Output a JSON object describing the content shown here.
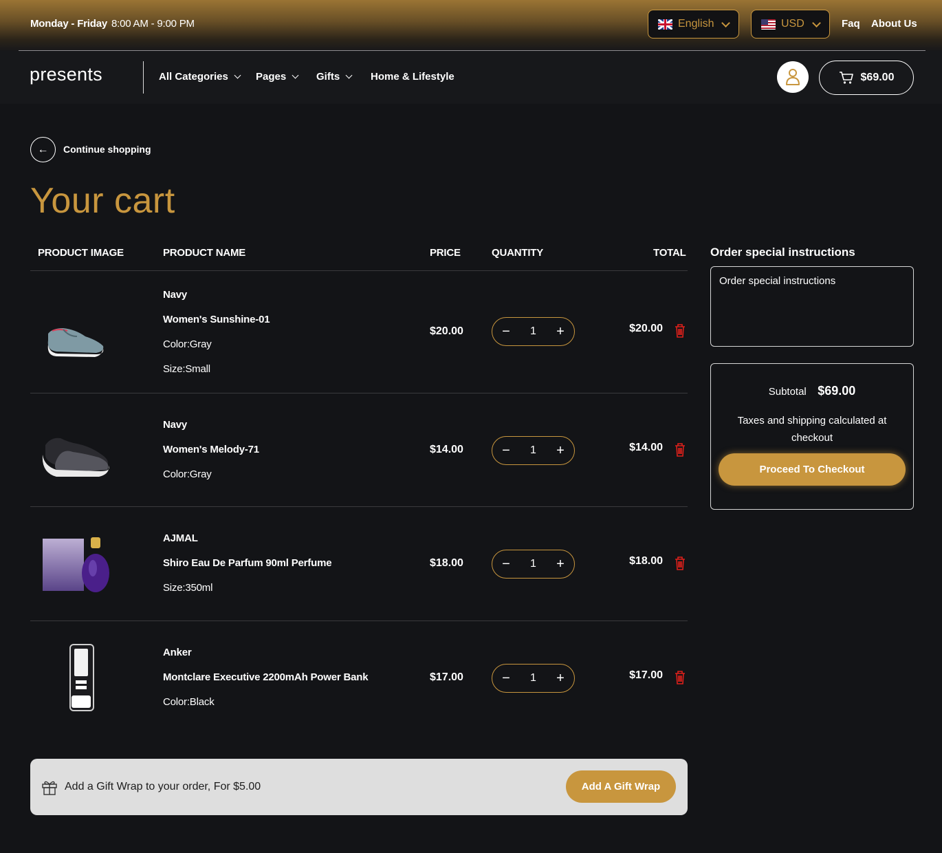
{
  "topbar": {
    "hours_days": "Monday - Friday",
    "hours_time": "8:00 AM - 9:00 PM",
    "language": "English",
    "currency": "USD",
    "faq": "Faq",
    "about": "About Us"
  },
  "nav": {
    "logo": "presents",
    "items": [
      {
        "label": "All Categories"
      },
      {
        "label": "Pages"
      },
      {
        "label": "Gifts"
      },
      {
        "label": "Home & Lifestyle"
      }
    ],
    "cart_total": "$69.00"
  },
  "page": {
    "continue_label": "Continue shopping",
    "title": "Your cart"
  },
  "table": {
    "headers": {
      "image": "PRODUCT IMAGE",
      "name": "PRODUCT NAME",
      "price": "PRICE",
      "quantity": "QUANTITY",
      "total": "TOTAL"
    },
    "rows": [
      {
        "brand": "Navy",
        "name": "Women's Sunshine-01",
        "opt1": "Color:Gray",
        "opt2": "Size:Small",
        "price": "$20.00",
        "qty": "1",
        "total": "$20.00",
        "image": "gray-slip-on-sneaker"
      },
      {
        "brand": "Navy",
        "name": "Women's Melody-71",
        "opt1": "Color:Gray",
        "price": "$14.00",
        "qty": "1",
        "total": "$14.00",
        "image": "black-gray-sneaker"
      },
      {
        "brand": "AJMAL",
        "name": "Shiro Eau De Parfum 90ml Perfume",
        "opt1": "Size:350ml",
        "price": "$18.00",
        "qty": "1",
        "total": "$18.00",
        "image": "purple-perfume-box"
      },
      {
        "brand": "Anker",
        "name": "Montclare Executive 2200mAh Power Bank",
        "opt1": "Color:Black",
        "price": "$17.00",
        "qty": "1",
        "total": "$17.00",
        "image": "black-power-bank"
      }
    ]
  },
  "sidebar": {
    "title": "Order special instructions",
    "notes_placeholder": "Order special instructions",
    "subtotal_label": "Subtotal",
    "subtotal_value": "$69.00",
    "tax_note": "Taxes and shipping calculated at checkout",
    "checkout_label": "Proceed To Checkout"
  },
  "gift": {
    "text": "Add a Gift Wrap to your order, For $5.00",
    "button": "Add A Gift Wrap"
  },
  "colors": {
    "accent": "#c8963e",
    "background": "#131417",
    "delete": "#e0201b"
  }
}
